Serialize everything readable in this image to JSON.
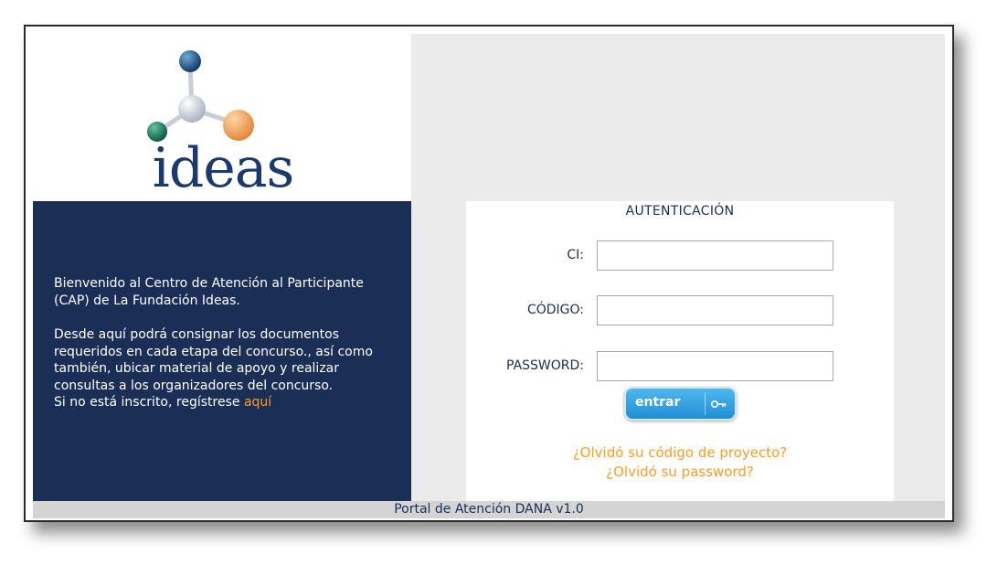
{
  "logo": {
    "text": "ideas",
    "colors": {
      "text": "#1b3a6b",
      "node_top": "#1b4f82",
      "node_center": "#d8dde3",
      "node_left": "#1a7a5c",
      "node_right": "#f0a150"
    }
  },
  "welcome": {
    "paragraph1": "Bienvenido al Centro de Atención al Participante (CAP) de La Fundación Ideas.",
    "paragraph2": "Desde aquí podrá consignar los documentos requeridos en cada etapa del concurso., así como también, ubicar material de apoyo y realizar consultas a los organizadores del concurso.",
    "register_prefix": "Si no está inscrito, regístrese ",
    "register_link": "aquí"
  },
  "login": {
    "title": "AUTENTICACIÓN",
    "ci_label": "CI:",
    "ci_value": "",
    "code_label": "CÓDIGO:",
    "code_value": "",
    "password_label": "PASSWORD:",
    "password_value": "",
    "submit_label": "entrar",
    "submit_icon": "key-icon",
    "forgot_code": "¿Olvidó su código de proyecto?",
    "forgot_password": "¿Olvidó su password?"
  },
  "footer": {
    "text": "Portal de Atención DANA v1.0"
  },
  "colors": {
    "navy": "#1b2e56",
    "link_orange": "#ff9c2a",
    "button_blue": "#2e9ee0"
  }
}
